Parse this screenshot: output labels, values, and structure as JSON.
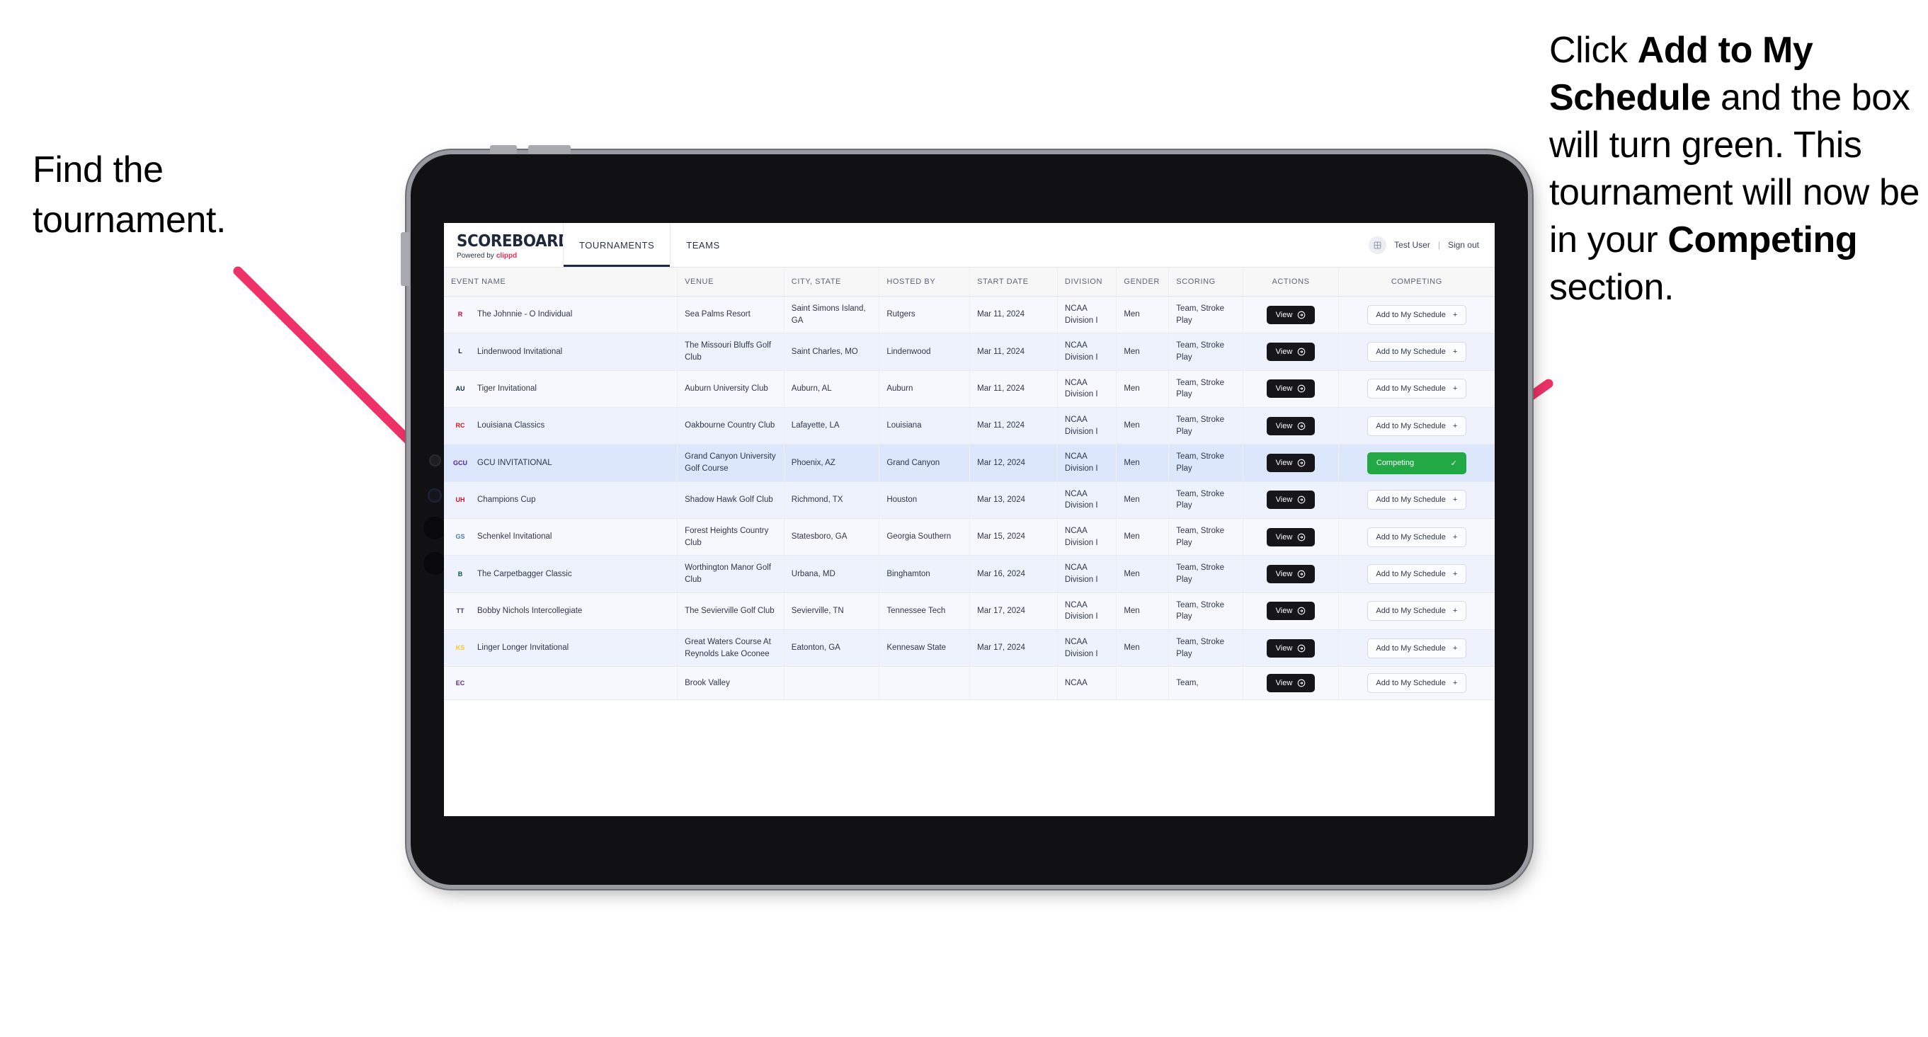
{
  "annotations": {
    "left": "Find the tournament.",
    "right_parts": [
      {
        "t": "Click ",
        "b": false
      },
      {
        "t": "Add to My Schedule",
        "b": true
      },
      {
        "t": " and the box will turn green. This tournament will now be in your ",
        "b": false
      },
      {
        "t": "Competing",
        "b": true
      },
      {
        "t": " section.",
        "b": false
      }
    ],
    "arrow_color": "#ee3267"
  },
  "app": {
    "brand": {
      "title": "SCOREBOARD",
      "powered_prefix": "Powered by",
      "powered_accent": "clippd"
    },
    "nav": [
      {
        "label": "TOURNAMENTS",
        "active": true
      },
      {
        "label": "TEAMS",
        "active": false
      }
    ],
    "user": {
      "avatar_icon": "user-badge-icon",
      "name": "Test User",
      "separator": "|",
      "signout": "Sign out"
    }
  },
  "table": {
    "columns": [
      "EVENT NAME",
      "VENUE",
      "CITY, STATE",
      "HOSTED BY",
      "START DATE",
      "DIVISION",
      "GENDER",
      "SCORING",
      "ACTIONS",
      "COMPETING"
    ],
    "buttons": {
      "view": "View",
      "add": "Add to My Schedule",
      "add_icon": "+",
      "competing": "Competing",
      "competing_icon": "✓"
    },
    "accent_green": "#22a845",
    "rows": [
      {
        "logo": "rutgers-logo",
        "logo_text": "R",
        "logo_color": "#cc0033",
        "event": "The Johnnie - O Individual",
        "venue": "Sea Palms Resort",
        "city": "Saint Simons Island, GA",
        "host": "Rutgers",
        "date": "Mar 11, 2024",
        "division": "NCAA Division I",
        "gender": "Men",
        "scoring": "Team, Stroke Play",
        "competing": false,
        "selected": false
      },
      {
        "logo": "lindenwood-lions-logo",
        "logo_text": "L",
        "logo_color": "#1a1a1a",
        "event": "Lindenwood Invitational",
        "venue": "The Missouri Bluffs Golf Club",
        "city": "Saint Charles, MO",
        "host": "Lindenwood",
        "date": "Mar 11, 2024",
        "division": "NCAA Division I",
        "gender": "Men",
        "scoring": "Team, Stroke Play",
        "competing": false,
        "selected": false
      },
      {
        "logo": "auburn-tigers-logo",
        "logo_text": "AU",
        "logo_color": "#0c2340",
        "event": "Tiger Invitational",
        "venue": "Auburn University Club",
        "city": "Auburn, AL",
        "host": "Auburn",
        "date": "Mar 11, 2024",
        "division": "NCAA Division I",
        "gender": "Men",
        "scoring": "Team, Stroke Play",
        "competing": false,
        "selected": false
      },
      {
        "logo": "ragin-cajuns-logo",
        "logo_text": "RC",
        "logo_color": "#ce181e",
        "event": "Louisiana Classics",
        "venue": "Oakbourne Country Club",
        "city": "Lafayette, LA",
        "host": "Louisiana",
        "date": "Mar 11, 2024",
        "division": "NCAA Division I",
        "gender": "Men",
        "scoring": "Team, Stroke Play",
        "competing": false,
        "selected": false
      },
      {
        "logo": "grand-canyon-lopes-logo",
        "logo_text": "GCU",
        "logo_color": "#522398",
        "event": "GCU INVITATIONAL",
        "venue": "Grand Canyon University Golf Course",
        "city": "Phoenix, AZ",
        "host": "Grand Canyon",
        "date": "Mar 12, 2024",
        "division": "NCAA Division I",
        "gender": "Men",
        "scoring": "Team, Stroke Play",
        "competing": true,
        "selected": true
      },
      {
        "logo": "houston-cougars-logo",
        "logo_text": "UH",
        "logo_color": "#c8102e",
        "event": "Champions Cup",
        "venue": "Shadow Hawk Golf Club",
        "city": "Richmond, TX",
        "host": "Houston",
        "date": "Mar 13, 2024",
        "division": "NCAA Division I",
        "gender": "Men",
        "scoring": "Team, Stroke Play",
        "competing": false,
        "selected": false
      },
      {
        "logo": "georgia-southern-eagles-logo",
        "logo_text": "GS",
        "logo_color": "#4a7fa5",
        "event": "Schenkel Invitational",
        "venue": "Forest Heights Country Club",
        "city": "Statesboro, GA",
        "host": "Georgia Southern",
        "date": "Mar 15, 2024",
        "division": "NCAA Division I",
        "gender": "Men",
        "scoring": "Team, Stroke Play",
        "competing": false,
        "selected": false
      },
      {
        "logo": "binghamton-bearcats-logo",
        "logo_text": "B",
        "logo_color": "#00594f",
        "event": "The Carpetbagger Classic",
        "venue": "Worthington Manor Golf Club",
        "city": "Urbana, MD",
        "host": "Binghamton",
        "date": "Mar 16, 2024",
        "division": "NCAA Division I",
        "gender": "Men",
        "scoring": "Team, Stroke Play",
        "competing": false,
        "selected": false
      },
      {
        "logo": "tennessee-tech-golden-eagles-logo",
        "logo_text": "TT",
        "logo_color": "#4b2e83",
        "event": "Bobby Nichols Intercollegiate",
        "venue": "The Sevierville Golf Club",
        "city": "Sevierville, TN",
        "host": "Tennessee Tech",
        "date": "Mar 17, 2024",
        "division": "NCAA Division I",
        "gender": "Men",
        "scoring": "Team, Stroke Play",
        "competing": false,
        "selected": false
      },
      {
        "logo": "kennesaw-state-owls-logo",
        "logo_text": "KS",
        "logo_color": "#ffc629",
        "event": "Linger Longer Invitational",
        "venue": "Great Waters Course At Reynolds Lake Oconee",
        "city": "Eatonton, GA",
        "host": "Kennesaw State",
        "date": "Mar 17, 2024",
        "division": "NCAA Division I",
        "gender": "Men",
        "scoring": "Team, Stroke Play",
        "competing": false,
        "selected": false
      },
      {
        "logo": "east-carolina-pirates-logo",
        "logo_text": "EC",
        "logo_color": "#592a8a",
        "event": "",
        "venue": "Brook Valley",
        "city": "",
        "host": "",
        "date": "",
        "division": "NCAA",
        "gender": "",
        "scoring": "Team,",
        "competing": false,
        "selected": false
      }
    ]
  }
}
